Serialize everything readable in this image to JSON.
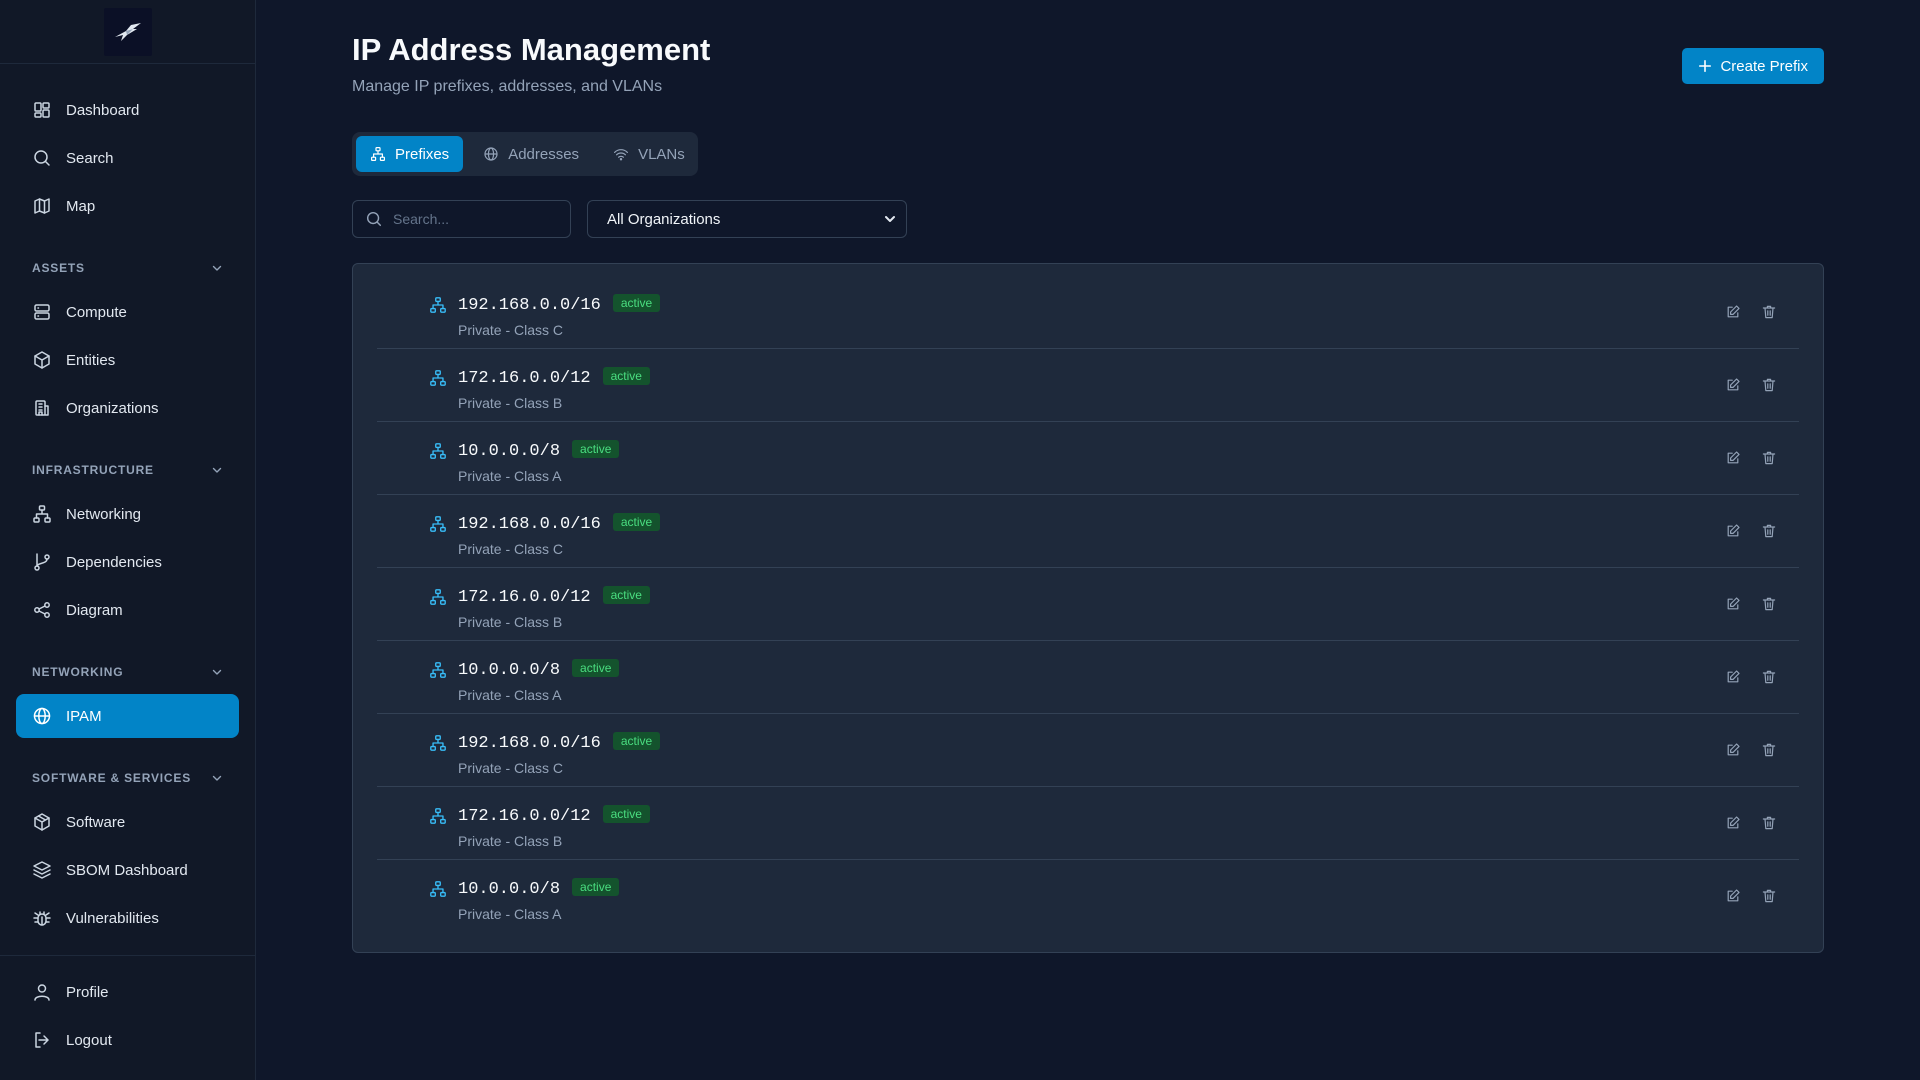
{
  "sidebar": {
    "primary": [
      {
        "label": "Dashboard",
        "icon": "dashboard-icon"
      },
      {
        "label": "Search",
        "icon": "search-icon"
      },
      {
        "label": "Map",
        "icon": "map-icon"
      }
    ],
    "sections": [
      {
        "title": "ASSETS",
        "items": [
          {
            "label": "Compute",
            "icon": "server-icon"
          },
          {
            "label": "Entities",
            "icon": "cube-icon"
          },
          {
            "label": "Organizations",
            "icon": "building-icon"
          }
        ]
      },
      {
        "title": "INFRASTRUCTURE",
        "items": [
          {
            "label": "Networking",
            "icon": "network-icon"
          },
          {
            "label": "Dependencies",
            "icon": "git-branch-icon"
          },
          {
            "label": "Diagram",
            "icon": "share-icon"
          }
        ]
      },
      {
        "title": "NETWORKING",
        "items": [
          {
            "label": "IPAM",
            "icon": "globe-icon",
            "active": true
          }
        ]
      },
      {
        "title": "SOFTWARE & SERVICES",
        "items": [
          {
            "label": "Software",
            "icon": "package-icon"
          },
          {
            "label": "SBOM Dashboard",
            "icon": "layers-icon"
          },
          {
            "label": "Vulnerabilities",
            "icon": "bug-icon"
          }
        ]
      }
    ],
    "footer": [
      {
        "label": "Profile",
        "icon": "user-icon"
      },
      {
        "label": "Logout",
        "icon": "logout-icon"
      }
    ]
  },
  "header": {
    "title": "IP Address Management",
    "subtitle": "Manage IP prefixes, addresses, and VLANs",
    "create_label": "Create Prefix"
  },
  "tabs": [
    {
      "label": "Prefixes",
      "icon": "network-icon",
      "active": true
    },
    {
      "label": "Addresses",
      "icon": "globe-icon",
      "active": false
    },
    {
      "label": "VLANs",
      "icon": "wifi-icon",
      "active": false
    }
  ],
  "filters": {
    "search_placeholder": "Search...",
    "org_selected": "All Organizations"
  },
  "prefixes": [
    {
      "prefix": "192.168.0.0/16",
      "status": "active",
      "description": "Private - Class C"
    },
    {
      "prefix": "172.16.0.0/12",
      "status": "active",
      "description": "Private - Class B"
    },
    {
      "prefix": "10.0.0.0/8",
      "status": "active",
      "description": "Private - Class A"
    },
    {
      "prefix": "192.168.0.0/16",
      "status": "active",
      "description": "Private - Class C"
    },
    {
      "prefix": "172.16.0.0/12",
      "status": "active",
      "description": "Private - Class B"
    },
    {
      "prefix": "10.0.0.0/8",
      "status": "active",
      "description": "Private - Class A"
    },
    {
      "prefix": "192.168.0.0/16",
      "status": "active",
      "description": "Private - Class C"
    },
    {
      "prefix": "172.16.0.0/12",
      "status": "active",
      "description": "Private - Class B"
    },
    {
      "prefix": "10.0.0.0/8",
      "status": "active",
      "description": "Private - Class A"
    }
  ],
  "colors": {
    "accent": "#0284c7",
    "background": "#0f172a",
    "card": "#1e293b",
    "badge_bg": "#14532d",
    "badge_text": "#4ade80",
    "prefix_icon": "#38bdf8"
  }
}
